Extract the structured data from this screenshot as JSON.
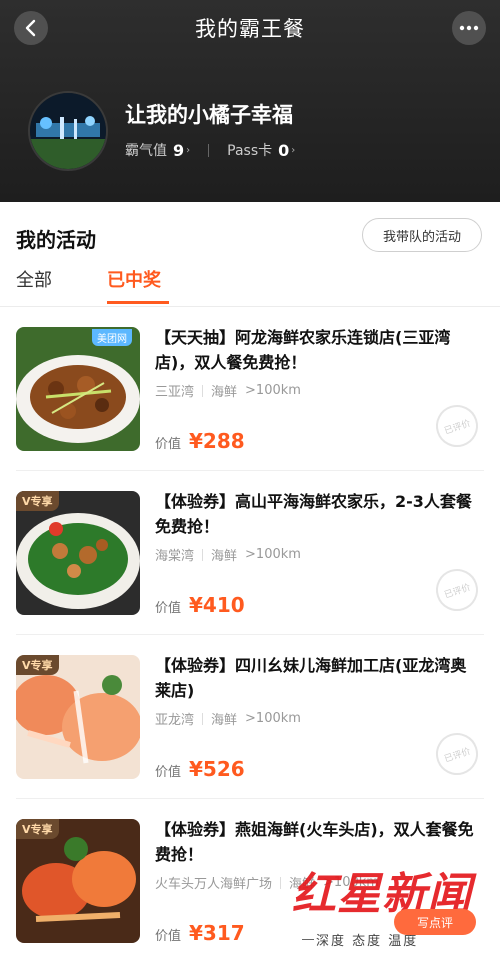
{
  "header": {
    "title": "我的霸王餐",
    "username": "让我的小橘子幸福",
    "stats": [
      {
        "label": "霸气值",
        "value": "9"
      },
      {
        "label": "Pass卡",
        "value": "0"
      }
    ]
  },
  "activities": {
    "title": "我的活动",
    "team_button": "我带队的活动",
    "tabs": [
      "全部",
      "已中奖"
    ],
    "active_tab": "已中奖"
  },
  "cards": [
    {
      "badge": "",
      "title": "【天天抽】阿龙海鲜农家乐连锁店(三亚湾店)，双人餐免费抢！",
      "location": "三亚湾",
      "category": "海鲜",
      "distance": ">100km",
      "price_label": "价值",
      "price": "¥288",
      "stamp": "已评价"
    },
    {
      "badge": "V专享",
      "title": "【体验券】高山平海海鲜农家乐，2-3人套餐免费抢！",
      "location": "海棠湾",
      "category": "海鲜",
      "distance": ">100km",
      "price_label": "价值",
      "price": "¥410",
      "stamp": "已评价"
    },
    {
      "badge": "V专享",
      "title": "【体验券】四川幺妹儿海鲜加工店(亚龙湾奥莱店)",
      "location": "亚龙湾",
      "category": "海鲜",
      "distance": ">100km",
      "price_label": "价值",
      "price": "¥526",
      "stamp": "已评价"
    },
    {
      "badge": "V专享",
      "title": "【体验券】燕姐海鲜(火车头店)，双人套餐免费抢！",
      "location": "火车头万人海鲜广场",
      "category": "海鲜",
      "distance": ">100km",
      "price_label": "价值",
      "price": "¥317",
      "stamp": ""
    }
  ],
  "write_review_button": "写点评",
  "watermark": {
    "main": "红星新闻",
    "sub": "深度 态度 温度"
  },
  "colors": {
    "accent": "#ff5a1f",
    "header_bg": "#232323"
  }
}
